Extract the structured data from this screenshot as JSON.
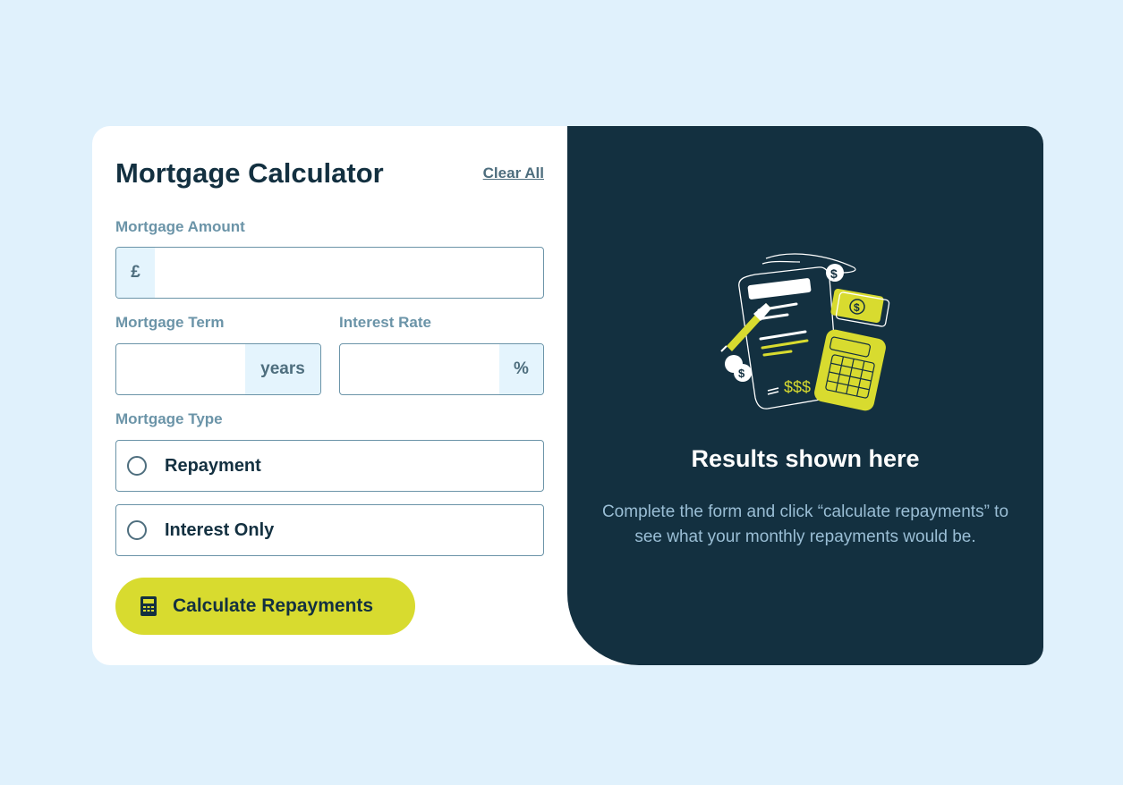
{
  "form": {
    "title": "Mortgage Calculator",
    "clear_all": "Clear All",
    "amount": {
      "label": "Mortgage Amount",
      "prefix": "£",
      "value": ""
    },
    "term": {
      "label": "Mortgage Term",
      "suffix": "years",
      "value": ""
    },
    "rate": {
      "label": "Interest Rate",
      "suffix": "%",
      "value": ""
    },
    "type": {
      "label": "Mortgage Type",
      "options": [
        {
          "label": "Repayment",
          "selected": false
        },
        {
          "label": "Interest Only",
          "selected": false
        }
      ]
    },
    "submit_label": "Calculate Repayments",
    "submit_icon": "calculator-icon"
  },
  "results": {
    "title": "Results shown here",
    "description": "Complete the form and click “calculate repayments” to see what your monthly repayments would be.",
    "illustration_icon": "empty-results-illustration"
  },
  "colors": {
    "background": "#e0f1fc",
    "dark": "#133040",
    "accent": "#d8db2f",
    "muted": "#6b94a8"
  }
}
